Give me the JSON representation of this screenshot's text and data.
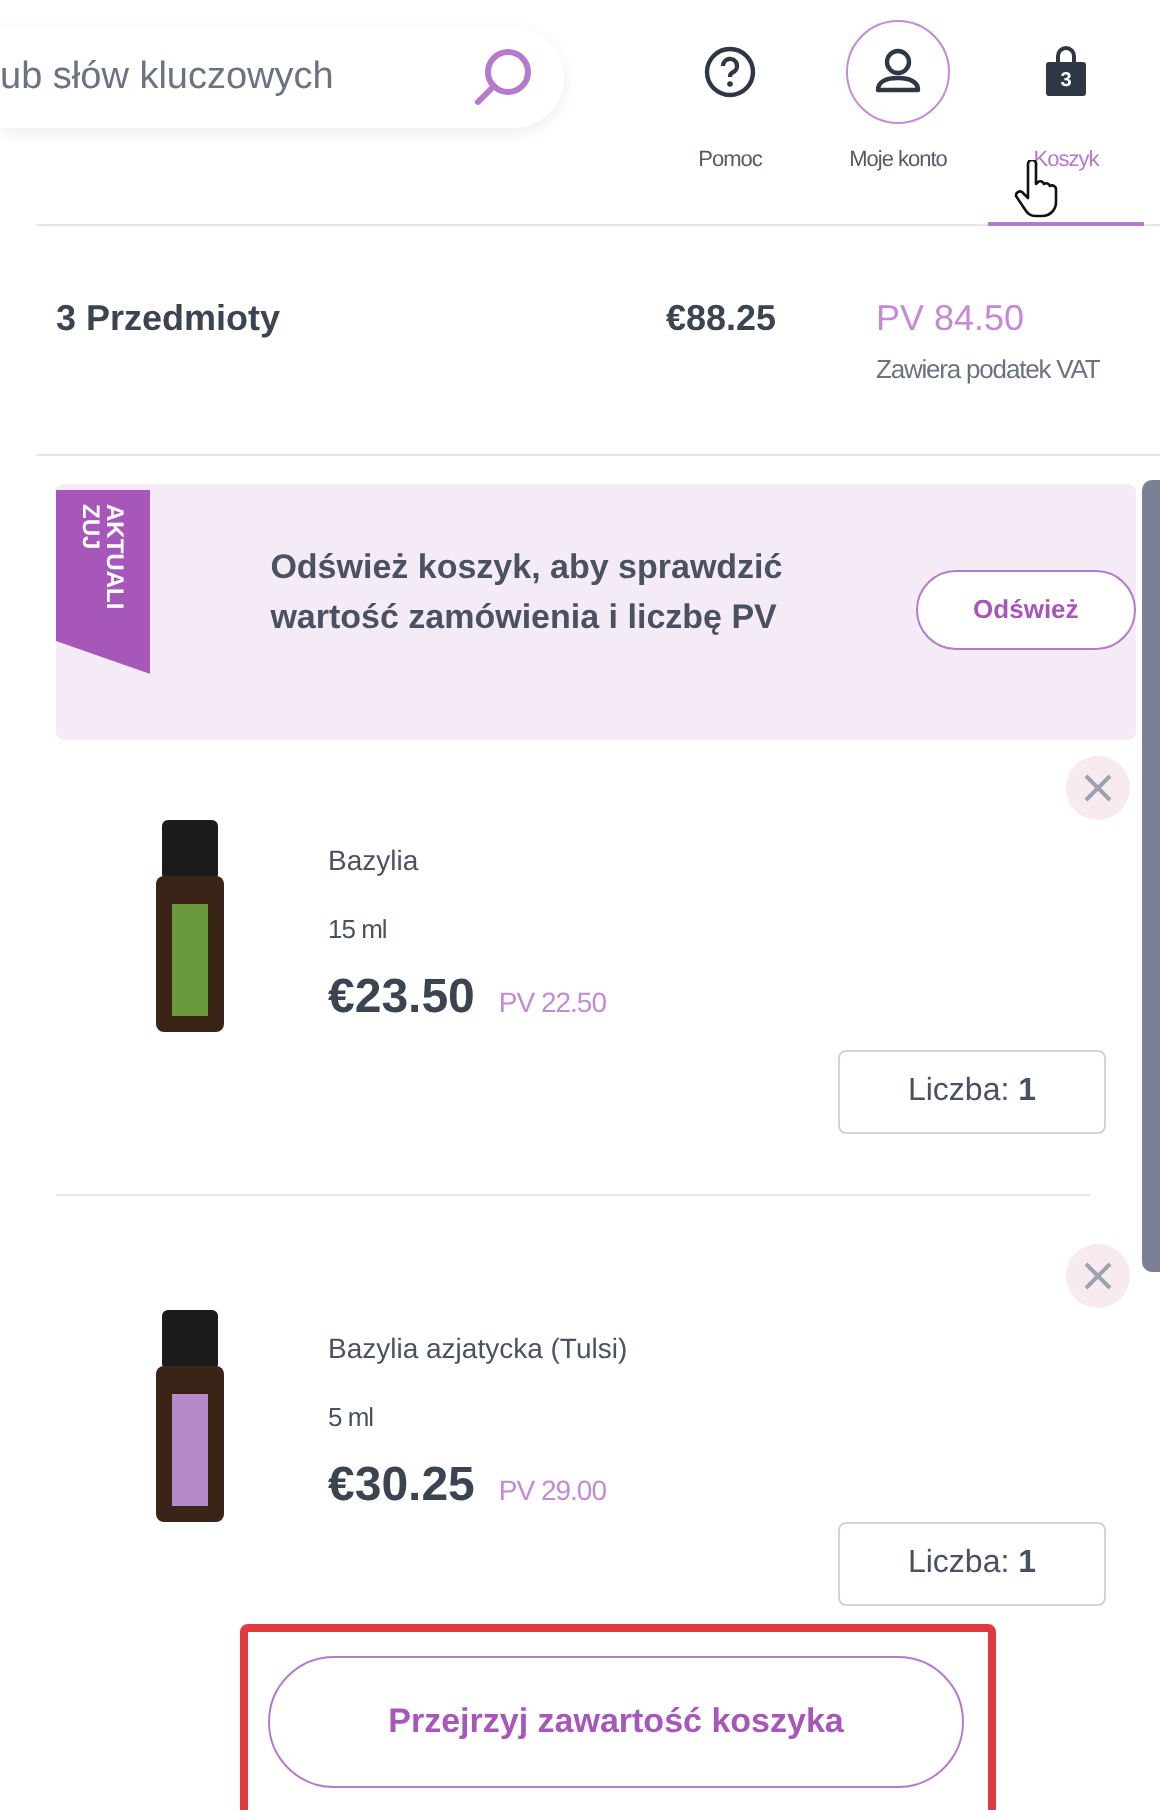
{
  "search": {
    "placeholder": "ub słów kluczowych"
  },
  "nav": [
    {
      "kind": "help",
      "label": "Pomoc",
      "selected": false
    },
    {
      "kind": "account",
      "label": "Moje konto",
      "selected": false
    },
    {
      "kind": "cart",
      "label": "Koszyk",
      "selected": true,
      "badge": "3"
    }
  ],
  "summary": {
    "items": "3 Przedmioty",
    "total": "€88.25",
    "pv": "PV 84.50",
    "tax_note": "Zawiera podatek VAT"
  },
  "banner": {
    "ribbon": "AKTUALIZUJ",
    "message": "Odśwież koszyk, aby sprawdzić wartość zamówienia i liczbę PV",
    "button": "Odśwież"
  },
  "products": [
    {
      "name": "Bazylia",
      "size": "15 ml",
      "price": "€23.50",
      "pv": "PV 22.50",
      "quantity_label": "Liczba:",
      "quantity": "1",
      "color": "#6a9a3c"
    },
    {
      "name": "Bazylia azjatycka (Tulsi)",
      "size": "5 ml",
      "price": "€30.25",
      "pv": "PV 29.00",
      "quantity_label": "Liczba:",
      "quantity": "1",
      "color": "#b58ac8"
    }
  ],
  "review_button": "Przejrzyj zawartość koszyka"
}
